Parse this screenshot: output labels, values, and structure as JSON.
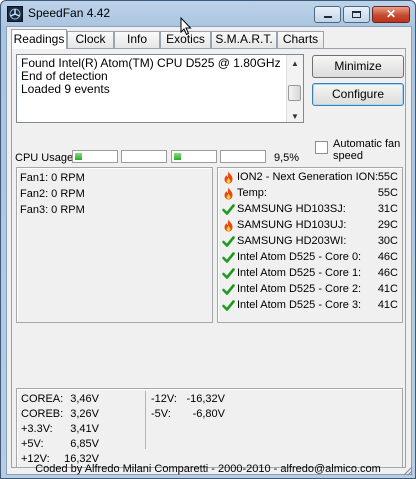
{
  "window": {
    "title": "SpeedFan 4.42"
  },
  "tabs": [
    {
      "label": "Readings",
      "active": true
    },
    {
      "label": "Clock"
    },
    {
      "label": "Info"
    },
    {
      "label": "Exotics"
    },
    {
      "label": "S.M.A.R.T."
    },
    {
      "label": "Charts"
    }
  ],
  "log": [
    "Found Intel(R) Atom(TM) CPU D525 @ 1.80GHz",
    "End of detection",
    "Loaded 9 events"
  ],
  "buttons": {
    "minimize": "Minimize",
    "configure": "Configure"
  },
  "auto_fan": {
    "label": "Automatic fan speed",
    "checked": false
  },
  "cpu": {
    "label": "CPU Usage",
    "usage_text": "9,5%",
    "core_levels": [
      0.18,
      0,
      0.18,
      0
    ]
  },
  "fans": [
    "Fan1: 0 RPM",
    "Fan2: 0 RPM",
    "Fan3: 0 RPM"
  ],
  "temps": [
    {
      "name": "ION2 - Next Generation ION:",
      "value": "55C",
      "icon": "flame-icon"
    },
    {
      "name": "Temp:",
      "value": "55C",
      "icon": "flame-icon"
    },
    {
      "name": "SAMSUNG HD103SJ:",
      "value": "31C",
      "icon": "check-icon"
    },
    {
      "name": "SAMSUNG HD103UJ:",
      "value": "29C",
      "icon": "flame-icon"
    },
    {
      "name": "SAMSUNG HD203WI:",
      "value": "30C",
      "icon": "check-icon"
    },
    {
      "name": "Intel Atom D525 - Core 0:",
      "value": "46C",
      "icon": "check-icon"
    },
    {
      "name": "Intel Atom D525 - Core 1:",
      "value": "46C",
      "icon": "check-icon"
    },
    {
      "name": "Intel Atom D525 - Core 2:",
      "value": "41C",
      "icon": "check-icon"
    },
    {
      "name": "Intel Atom D525 - Core 3:",
      "value": "41C",
      "icon": "check-icon"
    }
  ],
  "voltages_left": [
    {
      "label": "COREA:",
      "value": "3,46V"
    },
    {
      "label": "COREB:",
      "value": "3,26V"
    },
    {
      "label": "+3.3V:",
      "value": "3,41V"
    },
    {
      "label": "+5V:",
      "value": "6,85V"
    },
    {
      "label": "+12V:",
      "value": "16,32V"
    }
  ],
  "voltages_right": [
    {
      "label": "-12V:",
      "value": "-16,32V"
    },
    {
      "label": "-5V:",
      "value": "-6,80V"
    }
  ],
  "status": "Coded by Alfredo Milani Comparetti - 2000-2010 - alfredo@almico.com",
  "colors": {
    "flame": "#e84a10",
    "check": "#1f9a1f",
    "title_bar": "#a9c4df",
    "close_button": "#c74a30"
  }
}
